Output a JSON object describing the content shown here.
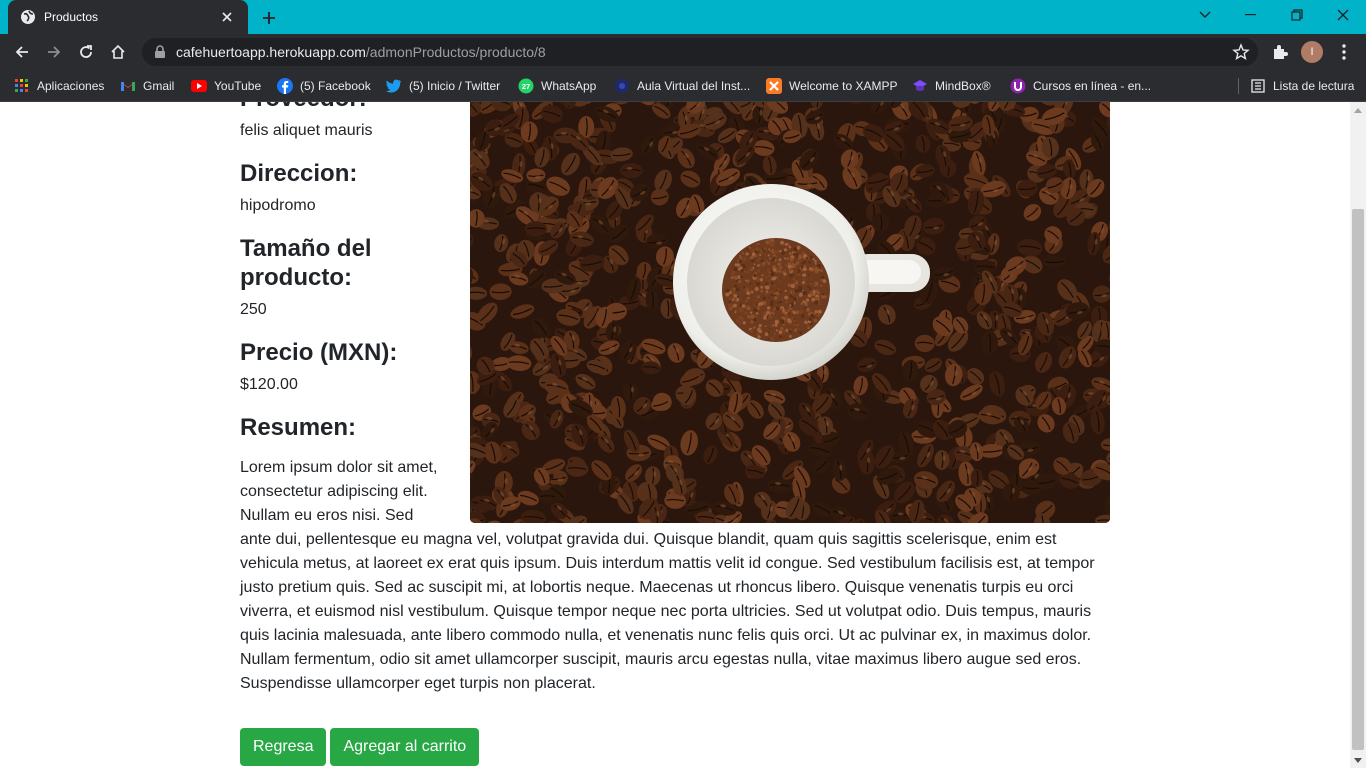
{
  "browser": {
    "tab_title": "Productos",
    "url_host": "cafehuertoapp.herokuapp.com",
    "url_path": "/admonProductos/producto/8",
    "profile_initial": "I",
    "colors": {
      "tabstrip": "#00b3c8",
      "toolbar": "#2b2c30"
    }
  },
  "bookmarks": [
    {
      "label": "Aplicaciones",
      "icon": "apps-grid-icon"
    },
    {
      "label": "Gmail",
      "icon": "gmail-icon"
    },
    {
      "label": "YouTube",
      "icon": "youtube-icon"
    },
    {
      "label": "(5) Facebook",
      "icon": "facebook-icon"
    },
    {
      "label": "(5) Inicio / Twitter",
      "icon": "twitter-icon"
    },
    {
      "label": "WhatsApp",
      "icon": "whatsapp-icon",
      "badge": "27"
    },
    {
      "label": "Aula Virtual del Inst...",
      "icon": "aula-virtual-icon"
    },
    {
      "label": "Welcome to XAMPP",
      "icon": "xampp-icon"
    },
    {
      "label": "MindBox®",
      "icon": "mindbox-icon"
    },
    {
      "label": "Cursos en línea - en...",
      "icon": "cursos-icon"
    }
  ],
  "reading_list": "Lista de lectura",
  "product": {
    "proveedor_label": "Proveedor:",
    "proveedor": "felis aliquet mauris",
    "direccion_label": "Direccion:",
    "direccion": "hipodromo",
    "tamano_label": "Tamaño del producto:",
    "tamano": "250",
    "precio_label": "Precio (MXN):",
    "precio": "$120.00",
    "resumen_label": "Resumen:",
    "resumen": "Lorem ipsum dolor sit amet, consectetur adipiscing elit. Nullam eu eros nisi. Sed ante dui, pellentesque eu magna vel, volutpat gravida dui. Quisque blandit, quam quis sagittis scelerisque, enim est vehicula metus, at laoreet ex erat quis ipsum. Duis interdum mattis velit id congue. Sed vestibulum facilisis est, at tempor justo pretium quis. Sed ac suscipit mi, at lobortis neque. Maecenas ut rhoncus libero. Quisque venenatis turpis eu orci viverra, et euismod nisl vestibulum. Quisque tempor neque nec porta ultricies. Sed ut volutpat odio. Duis tempus, mauris quis lacinia malesuada, ante libero commodo nulla, et venenatis nunc felis quis orci. Ut ac pulvinar ex, in maximus dolor. Nullam fermentum, odio sit amet ullamcorper suscipit, mauris arcu egestas nulla, vitae maximus libero augue sed eros. Suspendisse ullamcorper eget turpis non placerat."
  },
  "actions": {
    "regresa": "Regresa",
    "agregar": "Agregar al carrito",
    "button_color": "#28a745"
  }
}
